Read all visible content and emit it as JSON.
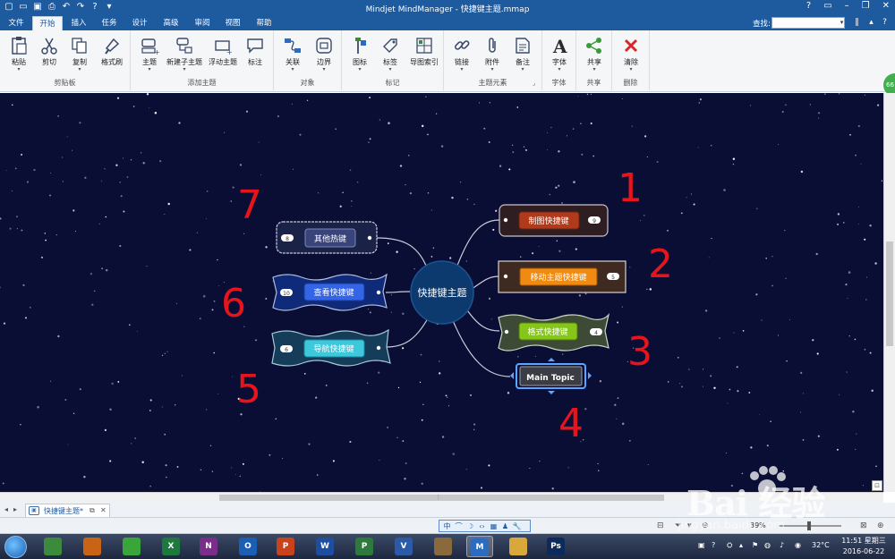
{
  "window": {
    "title": "Mindjet MindManager - 快捷键主题.mmap"
  },
  "tabs": [
    {
      "label": "文件"
    },
    {
      "label": "开始",
      "active": true
    },
    {
      "label": "插入"
    },
    {
      "label": "任务"
    },
    {
      "label": "设计"
    },
    {
      "label": "高级"
    },
    {
      "label": "审阅"
    },
    {
      "label": "视图"
    },
    {
      "label": "帮助"
    }
  ],
  "search": {
    "label": "查找:",
    "value": ""
  },
  "ribbon": {
    "groups": [
      {
        "label": "剪贴板",
        "buttons": [
          "粘贴",
          "剪切",
          "复制",
          "格式刷"
        ]
      },
      {
        "label": "添加主题",
        "buttons": [
          "主题",
          "新建子主题",
          "浮动主题",
          "标注"
        ]
      },
      {
        "label": "对象",
        "buttons": [
          "关联",
          "边界"
        ]
      },
      {
        "label": "标记",
        "buttons": [
          "图标",
          "标签",
          "导图索引"
        ]
      },
      {
        "label": "主题元素",
        "buttons": [
          "链接",
          "附件",
          "备注"
        ]
      },
      {
        "label": "字体",
        "buttons": [
          "字体"
        ]
      },
      {
        "label": "共享",
        "buttons": [
          "共享"
        ]
      },
      {
        "label": "删除",
        "buttons": [
          "清除"
        ]
      }
    ],
    "badge_text": "66"
  },
  "map": {
    "central": "快捷键主题",
    "topics": [
      {
        "label": "制图快捷键",
        "count": "9",
        "annotation": "1"
      },
      {
        "label": "移动主题快捷键",
        "count": "5",
        "annotation": "2"
      },
      {
        "label": "格式快捷键",
        "count": "4",
        "annotation": "3"
      },
      {
        "label": "Main Topic",
        "count": "",
        "annotation": "4"
      },
      {
        "label": "导航快捷键",
        "count": "6",
        "annotation": "5"
      },
      {
        "label": "查看快捷键",
        "count": "10",
        "annotation": "6"
      },
      {
        "label": "其他热键",
        "count": "8",
        "annotation": "7"
      }
    ],
    "colors": {
      "canvas": "#0a0e35",
      "central": "#0d3a6e",
      "annotation": "#e8141b"
    }
  },
  "document_tab": {
    "name": "快捷键主题*"
  },
  "ime_bar": [
    "中",
    "⌒",
    "☽",
    "‹›",
    "▦",
    "♟",
    "🔧"
  ],
  "statusbar": {
    "zoom": "39%"
  },
  "taskbar": {
    "apps": [
      {
        "label": "",
        "icon": "photos-icon",
        "color": "#3c8a3c"
      },
      {
        "label": "",
        "icon": "search-app-icon",
        "color": "#c86414"
      },
      {
        "label": "",
        "icon": "browser-icon",
        "color": "#3aa63a"
      },
      {
        "label": "X",
        "icon": "excel-icon",
        "color": "#1e7a3c"
      },
      {
        "label": "N",
        "icon": "onenote-icon",
        "color": "#7a2e8a"
      },
      {
        "label": "O",
        "icon": "outlook-icon",
        "color": "#1b5fb5"
      },
      {
        "label": "P",
        "icon": "powerpoint-icon",
        "color": "#c8421c"
      },
      {
        "label": "W",
        "icon": "word-icon",
        "color": "#1e4ea0"
      },
      {
        "label": "P",
        "icon": "project-icon",
        "color": "#2e7a3c"
      },
      {
        "label": "V",
        "icon": "visio-icon",
        "color": "#2a5aa8"
      },
      {
        "label": "",
        "icon": "cat-icon",
        "color": "#8a6a3c"
      },
      {
        "label": "M",
        "icon": "mindmanager-icon",
        "color": "#2b6cc0",
        "active": true
      },
      {
        "label": "",
        "icon": "explorer-icon",
        "color": "#d8a83a"
      },
      {
        "label": "Ps",
        "icon": "photoshop-icon",
        "color": "#0c2a5c"
      }
    ],
    "temperature": "32°C",
    "time": "11:51 星期三",
    "date": "2016-06-22"
  },
  "watermark": {
    "brand": "Bai 经验",
    "url": "jingyan.baidu.com"
  }
}
